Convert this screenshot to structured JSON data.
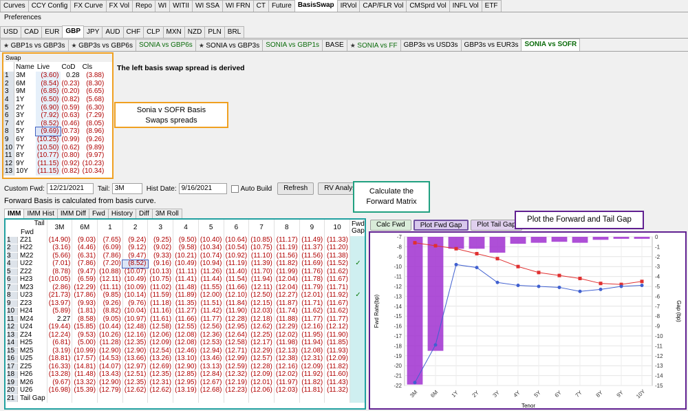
{
  "top_tabs": [
    "Curves",
    "CCY Config",
    "FX Curve",
    "FX Vol",
    "Repo",
    "WI",
    "WITII",
    "WI SSA",
    "WI FRN",
    "CT",
    "Future",
    "BasisSwap",
    "IRVol",
    "CAP/FLR Vol",
    "CMSprd Vol",
    "INFL Vol",
    "ETF"
  ],
  "top_active": "BasisSwap",
  "preferences_label": "Preferences",
  "ccy_tabs": [
    "USD",
    "CAD",
    "EUR",
    "GBP",
    "JPY",
    "AUD",
    "CHF",
    "CLP",
    "MXN",
    "NZD",
    "PLN",
    "BRL"
  ],
  "ccy_active": "GBP",
  "basis_tabs": [
    {
      "label": "GBP1s vs GBP3s",
      "star": true
    },
    {
      "label": "GBP3s vs GBP6s",
      "star": true
    },
    {
      "label": "SONIA vs GBP6s",
      "star": false,
      "green": true
    },
    {
      "label": "SONIA vs GBP3s",
      "star": true
    },
    {
      "label": "SONIA vs GBP1s",
      "star": false,
      "green": true
    },
    {
      "label": "BASE",
      "star": false
    },
    {
      "label": "SONIA vs FF",
      "star": true,
      "green": true
    },
    {
      "label": "GBP3s vs USD3s",
      "star": false
    },
    {
      "label": "GBP3s vs EUR3s",
      "star": false
    },
    {
      "label": "SONIA vs SOFR",
      "star": false,
      "active": true,
      "green": true
    }
  ],
  "swap_panel": {
    "title": "Swap",
    "headers": [
      "Name",
      "Live",
      "CoD",
      "Cls"
    ],
    "rows": [
      [
        "1",
        "3M",
        "(3.60)",
        "0.28",
        "(3.88)"
      ],
      [
        "2",
        "6M",
        "(8.54)",
        "(0.23)",
        "(8.30)"
      ],
      [
        "3",
        "9M",
        "(6.85)",
        "(0.20)",
        "(6.65)"
      ],
      [
        "4",
        "1Y",
        "(6.50)",
        "(0.82)",
        "(5.68)"
      ],
      [
        "5",
        "2Y",
        "(6.90)",
        "(0.59)",
        "(6.30)"
      ],
      [
        "6",
        "3Y",
        "(7.92)",
        "(0.63)",
        "(7.29)"
      ],
      [
        "7",
        "4Y",
        "(8.52)",
        "(0.46)",
        "(8.05)"
      ],
      [
        "8",
        "5Y",
        "(9.69)",
        "(0.73)",
        "(8.96)"
      ],
      [
        "9",
        "6Y",
        "(10.25)",
        "(0.99)",
        "(9.26)"
      ],
      [
        "10",
        "7Y",
        "(10.50)",
        "(0.62)",
        "(9.89)"
      ],
      [
        "11",
        "8Y",
        "(10.77)",
        "(0.80)",
        "(9.97)"
      ],
      [
        "12",
        "9Y",
        "(11.15)",
        "(0.92)",
        "(10.23)"
      ],
      [
        "13",
        "10Y",
        "(11.15)",
        "(0.82)",
        "(10.34)"
      ]
    ]
  },
  "derived_note": "The left basis swap spread is derived",
  "callout_sonia": [
    "Sonia v SOFR Basis",
    "Swaps spreads"
  ],
  "callout_fwd": [
    "Calculate the",
    "Forward Matrix"
  ],
  "callout_plot": "Plot the Forward and Tail Gap",
  "controls": {
    "custom_fwd_label": "Custom Fwd:",
    "custom_fwd_value": "12/21/2021",
    "tail_label": "Tail:",
    "tail_value": "3M",
    "hist_date_label": "Hist Date:",
    "hist_date_value": "9/16/2021",
    "auto_build_label": "Auto Build",
    "refresh_label": "Refresh",
    "rv_analysis_label": "RV Analysis"
  },
  "fwd_note": "Forward Basis is calculated from basis curve.",
  "matrix_tabs": [
    "IMM",
    "IMM Hist",
    "IMM Diff",
    "Fwd",
    "History",
    "Diff",
    "3M Roll"
  ],
  "matrix_active": "IMM",
  "matrix": {
    "corner_tail": "Tail",
    "corner_fwd": "Fwd",
    "columns": [
      "3M",
      "6M",
      "1",
      "2",
      "3",
      "4",
      "5",
      "6",
      "7",
      "8",
      "9",
      "10"
    ],
    "gap_header": [
      "Fwd",
      "Gap"
    ],
    "rows": [
      {
        "n": "1",
        "label": "Z21",
        "v": [
          "(14.90)",
          "(9.03)",
          "(7.65)",
          "(9.24)",
          "(9.25)",
          "(9.50)",
          "(10.40)",
          "(10.64)",
          "(10.85)",
          "(11.17)",
          "(11.49)",
          "(11.33)"
        ],
        "gap": ""
      },
      {
        "n": "2",
        "label": "H22",
        "v": [
          "(3.16)",
          "(4.46)",
          "(6.09)",
          "(9.12)",
          "(9.02)",
          "(9.58)",
          "(10.34)",
          "(10.54)",
          "(10.75)",
          "(11.19)",
          "(11.37)",
          "(11.20)"
        ],
        "gap": ""
      },
      {
        "n": "3",
        "label": "M22",
        "v": [
          "(5.66)",
          "(6.31)",
          "(7.86)",
          "(9.47)",
          "(9.33)",
          "(10.21)",
          "(10.74)",
          "(10.92)",
          "(11.10)",
          "(11.56)",
          "(11.56)",
          "(11.38)"
        ],
        "gap": ""
      },
      {
        "n": "4",
        "label": "U22",
        "v": [
          "(7.01)",
          "(7.86)",
          "(7.20)",
          "(8.52)",
          "(9.16)",
          "(10.49)",
          "(10.94)",
          "(11.19)",
          "(11.39)",
          "(11.82)",
          "(11.69)",
          "(11.52)"
        ],
        "gap": "✓"
      },
      {
        "n": "5",
        "label": "Z22",
        "v": [
          "(8.78)",
          "(9.47)",
          "(10.88)",
          "(10.07)",
          "(10.13)",
          "(11.11)",
          "(11.26)",
          "(11.40)",
          "(11.70)",
          "(11.99)",
          "(11.76)",
          "(11.62)"
        ],
        "gap": ""
      },
      {
        "n": "6",
        "label": "H23",
        "v": [
          "(10.05)",
          "(6.59)",
          "(12.11)",
          "(10.49)",
          "(10.75)",
          "(11.41)",
          "(11.44)",
          "(11.54)",
          "(11.94)",
          "(12.04)",
          "(11.78)",
          "(11.67)"
        ],
        "gap": ""
      },
      {
        "n": "7",
        "label": "M23",
        "v": [
          "(2.86)",
          "(12.29)",
          "(11.11)",
          "(10.09)",
          "(11.02)",
          "(11.48)",
          "(11.55)",
          "(11.66)",
          "(12.11)",
          "(12.04)",
          "(11.79)",
          "(11.71)"
        ],
        "gap": ""
      },
      {
        "n": "8",
        "label": "U23",
        "v": [
          "(21.73)",
          "(17.86)",
          "(9.85)",
          "(10.14)",
          "(11.59)",
          "(11.89)",
          "(12.00)",
          "(12.10)",
          "(12.50)",
          "(12.27)",
          "(12.01)",
          "(11.92)"
        ],
        "gap": "✓"
      },
      {
        "n": "9",
        "label": "Z23",
        "v": [
          "(13.97)",
          "(9.93)",
          "(9.26)",
          "(9.76)",
          "(11.18)",
          "(11.35)",
          "(11.51)",
          "(11.84)",
          "(12.15)",
          "(11.87)",
          "(11.71)",
          "(11.67)"
        ],
        "gap": ""
      },
      {
        "n": "10",
        "label": "H24",
        "v": [
          "(5.89)",
          "(1.81)",
          "(8.82)",
          "(10.04)",
          "(11.16)",
          "(11.27)",
          "(11.42)",
          "(11.90)",
          "(12.03)",
          "(11.74)",
          "(11.62)",
          "(11.62)"
        ],
        "gap": ""
      },
      {
        "n": "11",
        "label": "M24",
        "v": [
          "2.27",
          "(8.58)",
          "(9.05)",
          "(10.97)",
          "(11.61)",
          "(11.66)",
          "(11.77)",
          "(12.28)",
          "(12.18)",
          "(11.88)",
          "(11.77)",
          "(11.77)"
        ],
        "gap": ""
      },
      {
        "n": "12",
        "label": "U24",
        "v": [
          "(19.44)",
          "(15.85)",
          "(10.44)",
          "(12.48)",
          "(12.58)",
          "(12.55)",
          "(12.56)",
          "(12.95)",
          "(12.62)",
          "(12.29)",
          "(12.16)",
          "(12.12)"
        ],
        "gap": ""
      },
      {
        "n": "13",
        "label": "Z24",
        "v": [
          "(12.24)",
          "(9.53)",
          "(10.26)",
          "(12.16)",
          "(12.06)",
          "(12.08)",
          "(12.36)",
          "(12.64)",
          "(12.25)",
          "(12.02)",
          "(11.95)",
          "(11.90)"
        ],
        "gap": ""
      },
      {
        "n": "14",
        "label": "H25",
        "v": [
          "(6.81)",
          "(5.00)",
          "(11.28)",
          "(12.35)",
          "(12.09)",
          "(12.08)",
          "(12.53)",
          "(12.58)",
          "(12.17)",
          "(11.98)",
          "(11.94)",
          "(11.85)"
        ],
        "gap": ""
      },
      {
        "n": "15",
        "label": "M25",
        "v": [
          "(3.19)",
          "(10.99)",
          "(12.90)",
          "(12.90)",
          "(12.54)",
          "(12.46)",
          "(12.94)",
          "(12.71)",
          "(12.29)",
          "(12.13)",
          "(12.08)",
          "(11.93)"
        ],
        "gap": ""
      },
      {
        "n": "16",
        "label": "U25",
        "v": [
          "(18.81)",
          "(17.57)",
          "(14.53)",
          "(13.66)",
          "(13.26)",
          "(13.10)",
          "(13.46)",
          "(12.99)",
          "(12.57)",
          "(12.38)",
          "(12.31)",
          "(12.09)"
        ],
        "gap": ""
      },
      {
        "n": "17",
        "label": "Z25",
        "v": [
          "(16.33)",
          "(14.81)",
          "(14.07)",
          "(12.97)",
          "(12.69)",
          "(12.90)",
          "(13.13)",
          "(12.59)",
          "(12.28)",
          "(12.16)",
          "(12.09)",
          "(11.82)"
        ],
        "gap": ""
      },
      {
        "n": "18",
        "label": "H26",
        "v": [
          "(13.28)",
          "(11.48)",
          "(13.43)",
          "(12.51)",
          "(12.35)",
          "(12.85)",
          "(12.84)",
          "(12.32)",
          "(12.09)",
          "(12.02)",
          "(11.92)",
          "(11.60)"
        ],
        "gap": ""
      },
      {
        "n": "19",
        "label": "M26",
        "v": [
          "(9.67)",
          "(13.32)",
          "(12.90)",
          "(12.35)",
          "(12.31)",
          "(12.95)",
          "(12.67)",
          "(12.19)",
          "(12.01)",
          "(11.97)",
          "(11.82)",
          "(11.43)"
        ],
        "gap": ""
      },
      {
        "n": "20",
        "label": "U26",
        "v": [
          "(16.98)",
          "(15.39)",
          "(12.79)",
          "(12.62)",
          "(12.62)",
          "(13.19)",
          "(12.68)",
          "(12.23)",
          "(12.06)",
          "(12.03)",
          "(11.81)",
          "(11.32)"
        ],
        "gap": ""
      },
      {
        "n": "21",
        "label": "Tail Gap",
        "v": [
          "",
          "",
          "",
          "",
          "",
          "",
          "",
          "",
          "",
          "",
          "",
          ""
        ],
        "gap": ""
      }
    ]
  },
  "chart_buttons": {
    "calc_fwd": "Calc Fwd",
    "plot_fwd_gap": "Plot Fwd Gap",
    "plot_tail_gap": "Plot Tail Gap"
  },
  "chart_data": {
    "type": "bar",
    "categories": [
      "3M",
      "6M",
      "1Y",
      "2Y",
      "3Y",
      "4Y",
      "5Y",
      "6Y",
      "7Y",
      "8Y",
      "9Y",
      "10Y"
    ],
    "series": [
      {
        "kind": "bar",
        "axis": "right",
        "values": [
          -14.9,
          -11.5,
          -1.2,
          -1.2,
          -1.6,
          -0.7,
          -0.6,
          -0.5,
          -0.6,
          -0.3,
          -0.2,
          -0.2
        ]
      },
      {
        "kind": "line",
        "axis": "left",
        "color": "#e03030",
        "values": [
          -7.6,
          -7.9,
          -8.2,
          -8.7,
          -9.2,
          -10.0,
          -10.6,
          -10.9,
          -11.2,
          -11.7,
          -11.8,
          -11.5
        ]
      },
      {
        "kind": "line",
        "axis": "left",
        "color": "#4060d0",
        "values": [
          -21.7,
          -17.9,
          -9.8,
          -10.1,
          -11.6,
          -11.9,
          -12.0,
          -12.1,
          -12.5,
          -12.3,
          -12.0,
          -11.9
        ]
      }
    ],
    "ylabel": "Fwd Rate(bp)",
    "y2label": "Gap (bp)",
    "xlabel": "Tenor",
    "ylim": [
      -22,
      -7
    ],
    "y2lim": [
      -15,
      0
    ],
    "yticks": [
      "-7",
      "-8",
      "-9",
      "-10",
      "-11",
      "-12",
      "-13",
      "-14",
      "-15",
      "-16",
      "-17",
      "-18",
      "-19",
      "-20",
      "-21",
      "-22"
    ],
    "y2ticks": [
      "0",
      "-1",
      "-2",
      "-3",
      "-4",
      "-5",
      "-6",
      "-7",
      "-8",
      "-9",
      "-10",
      "-11",
      "-12",
      "-13",
      "-14",
      "-15"
    ],
    "bar_color": "#a030d0"
  }
}
